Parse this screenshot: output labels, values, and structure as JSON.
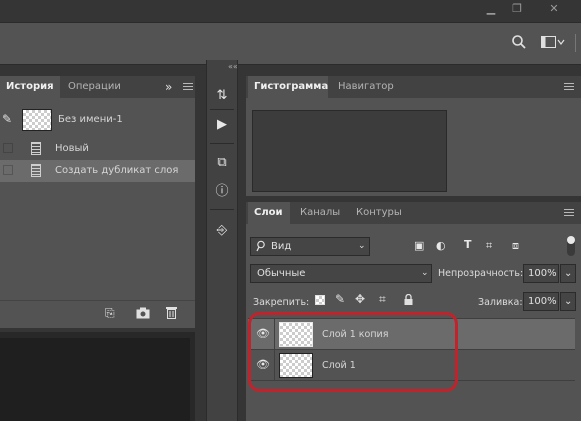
{
  "window": {
    "minimize_icon": "minimize-icon",
    "restore_icon": "restore-icon",
    "close_icon": "close-icon"
  },
  "left_panel": {
    "tabs": [
      "История",
      "Операции"
    ],
    "expand_glyph": "»",
    "snapshot_name": "Без имени-1",
    "history_items": [
      {
        "label": "Новый",
        "selected": false
      },
      {
        "label": "Создать дубликат слоя",
        "selected": true
      }
    ]
  },
  "right_top": {
    "tabs": [
      "Гистограмма",
      "Навигатор"
    ],
    "collapse_glyph": "««"
  },
  "layers_panel": {
    "tabs": [
      "Слои",
      "Каналы",
      "Контуры"
    ],
    "filter_value": "Вид",
    "blend_mode": "Обычные",
    "opacity_label": "Непрозрачность:",
    "opacity_value": "100%",
    "lock_label": "Закрепить:",
    "fill_label": "Заливка:",
    "fill_value": "100%",
    "layers": [
      {
        "name": "Слой 1 копия",
        "selected": true
      },
      {
        "name": "Слой 1",
        "selected": false
      }
    ]
  },
  "colors": {
    "panel_bg": "#535353",
    "tab_bar_bg": "#424242",
    "selection_bg": "#6b6b6b",
    "highlight_ring": "#c0232c"
  }
}
